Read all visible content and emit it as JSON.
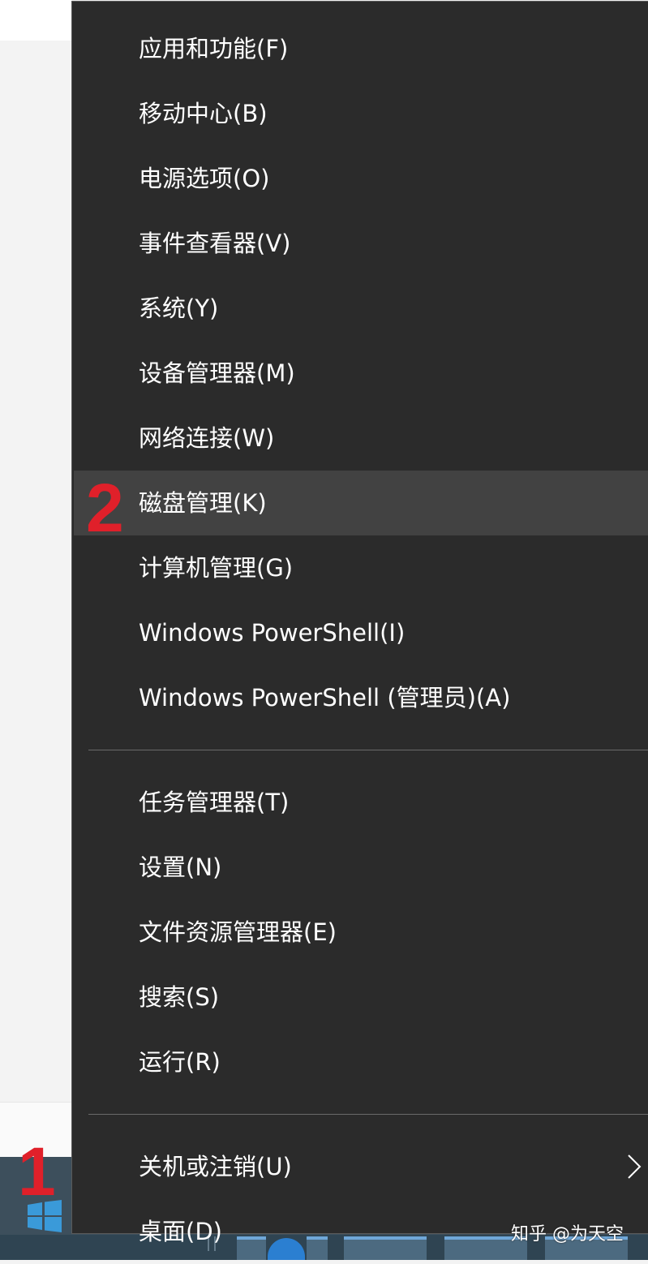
{
  "menu": {
    "groups": [
      [
        {
          "label": "应用和功能(F)"
        },
        {
          "label": "移动中心(B)"
        },
        {
          "label": "电源选项(O)"
        },
        {
          "label": "事件查看器(V)"
        },
        {
          "label": "系统(Y)"
        },
        {
          "label": "设备管理器(M)"
        },
        {
          "label": "网络连接(W)"
        },
        {
          "label": "磁盘管理(K)",
          "highlighted": true
        },
        {
          "label": "计算机管理(G)"
        },
        {
          "label": "Windows PowerShell(I)"
        },
        {
          "label": "Windows PowerShell (管理员)(A)"
        }
      ],
      [
        {
          "label": "任务管理器(T)"
        },
        {
          "label": "设置(N)"
        },
        {
          "label": "文件资源管理器(E)"
        },
        {
          "label": "搜索(S)"
        },
        {
          "label": "运行(R)"
        }
      ],
      [
        {
          "label": "关机或注销(U)",
          "submenu": true
        },
        {
          "label": "桌面(D)"
        }
      ]
    ]
  },
  "annotations": {
    "step1": "1",
    "step2": "2"
  },
  "watermark": "知乎 @为天空",
  "icons": {
    "start": "windows-logo-icon",
    "submenu": "chevron-right-icon"
  },
  "colors": {
    "menu_background": "#2b2b2b",
    "menu_highlight": "#424242",
    "menu_text": "#ffffff",
    "annotation": "#e0202a",
    "taskbar": "#3d4f5c",
    "start_logo": "#3a9ad9"
  }
}
